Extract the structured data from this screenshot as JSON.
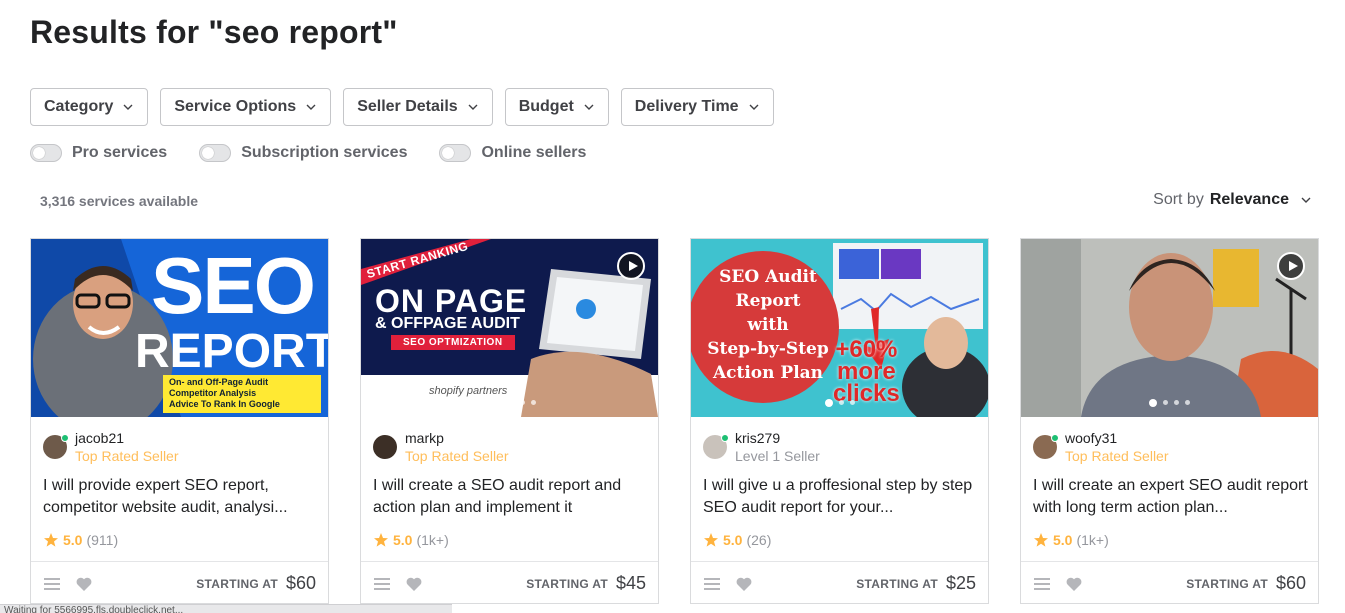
{
  "page": {
    "title": "Results for \"seo report\""
  },
  "filters": [
    "Category",
    "Service Options",
    "Seller Details",
    "Budget",
    "Delivery Time"
  ],
  "toggles": [
    "Pro services",
    "Subscription services",
    "Online sellers"
  ],
  "results": {
    "count_text": "3,316 services available",
    "sort_label": "Sort by",
    "sort_value": "Relevance"
  },
  "cards": [
    {
      "seller": "jacob21",
      "level": "Top Rated Seller",
      "title": "I will provide expert SEO report, competitor website audit, analysi...",
      "score": "5.0",
      "reviews": "(911)",
      "starting": "STARTING AT",
      "price": "$60",
      "thumb": {
        "big1": "SEO",
        "big2": "REPORT",
        "bullets": [
          "On- and Off-Page Audit",
          "Competitor Analysis",
          "Advice To Rank In Google"
        ]
      }
    },
    {
      "seller": "markp",
      "level": "Top Rated Seller",
      "title": "I will create a SEO audit report and action plan and implement it",
      "score": "5.0",
      "reviews": "(1k+)",
      "starting": "STARTING AT",
      "price": "$45",
      "thumb": {
        "ribbon": "START RANKING",
        "big1": "ON PAGE",
        "big2": "& OFFPAGE AUDIT",
        "sub": "SEO OPTMIZATION",
        "partner": "shopify partners"
      }
    },
    {
      "seller": "kris279",
      "level": "Level 1 Seller",
      "title": "I will give u a proffesional step by step SEO audit report for your...",
      "score": "5.0",
      "reviews": "(26)",
      "starting": "STARTING AT",
      "price": "$25",
      "thumb": {
        "lines": [
          "SEO Audit",
          "Report",
          "with",
          "Step-by-Step",
          "Action Plan"
        ],
        "promo1": "+60%",
        "promo2": "more",
        "promo3": "clicks"
      }
    },
    {
      "seller": "woofy31",
      "level": "Top Rated Seller",
      "title": "I will create an expert SEO audit report with long term action plan...",
      "score": "5.0",
      "reviews": "(1k+)",
      "starting": "STARTING AT",
      "price": "$60"
    }
  ],
  "status_bar": "Waiting for 5566995.fls.doubleclick.net..."
}
